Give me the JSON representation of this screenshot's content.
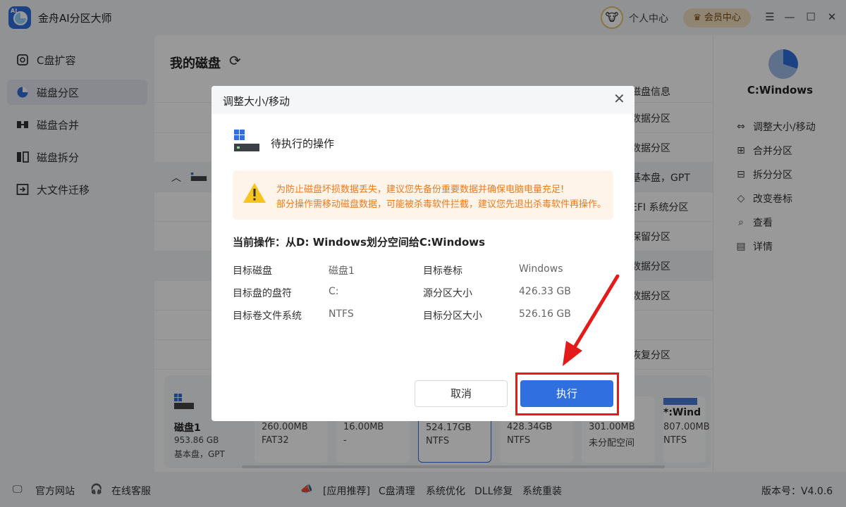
{
  "app": {
    "title": "金舟AI分区大师",
    "logo_text": "AI",
    "user_center": "个人中心",
    "member_center": "会员中心",
    "version": "版本号：V4.0.6"
  },
  "sidebar": {
    "items": [
      {
        "label": "C盘扩容",
        "icon": "drive-icon"
      },
      {
        "label": "磁盘分区",
        "icon": "partition-pie-icon",
        "active": true
      },
      {
        "label": "磁盘合并",
        "icon": "merge-icon"
      },
      {
        "label": "磁盘拆分",
        "icon": "split-icon"
      },
      {
        "label": "大文件迁移",
        "icon": "migrate-icon"
      }
    ]
  },
  "main": {
    "title": "我的磁盘",
    "column_header": "磁盘信息",
    "rows": [
      "数据分区",
      "数据分区",
      "基本盘，GPT",
      "EFI 系统分区",
      "保留分区",
      "数据分区",
      "数据分区",
      "",
      "恢复分区"
    ]
  },
  "disk_strip": {
    "disk_name": "磁盘1",
    "disk_size": "953.86 GB",
    "disk_type": "基本盘，GPT",
    "partitions": [
      {
        "size": "260.00MB",
        "fs": "FAT32",
        "name": ""
      },
      {
        "size": "16.00MB",
        "fs": "-",
        "name": ""
      },
      {
        "size": "524.17GB",
        "fs": "NTFS",
        "name": "",
        "selected": true
      },
      {
        "size": "428.34GB",
        "fs": "NTFS",
        "name": ""
      },
      {
        "size": "301.00MB",
        "fs": "未分配空间",
        "name": ""
      },
      {
        "size": "807.00MB",
        "fs": "NTFS",
        "name": "*:Wind"
      }
    ]
  },
  "right_panel": {
    "title": "C:Windows",
    "actions": [
      {
        "label": "调整大小/移动",
        "icon": "resize-icon"
      },
      {
        "label": "合并分区",
        "icon": "merge-icon"
      },
      {
        "label": "拆分分区",
        "icon": "split-icon"
      },
      {
        "label": "改变卷标",
        "icon": "tag-icon"
      },
      {
        "label": "查看",
        "icon": "search-doc-icon"
      },
      {
        "label": "详情",
        "icon": "detail-icon"
      }
    ]
  },
  "footer": {
    "website": "官方网站",
    "service": "在线客服",
    "recommend": "[应用推荐]",
    "links": [
      "C盘清理",
      "系统优化",
      "DLL修复",
      "系统重装"
    ]
  },
  "dialog": {
    "title": "调整大小/移动",
    "pending_label": "待执行的操作",
    "warning_line1": "为防止磁盘坏损数据丢失，建议您先备份重要数据并确保电脑电量充足!",
    "warning_line2": "部分操作需移动磁盘数据，可能被杀毒软件拦截，建议您先退出杀毒软件再操作。",
    "current_op_label": "当前操作：",
    "current_op_value": "从D: Windows划分空间给C:Windows",
    "details_left": [
      {
        "key": "目标磁盘",
        "value": "磁盘1"
      },
      {
        "key": "目标盘的盘符",
        "value": "C:"
      },
      {
        "key": "目标卷文件系统",
        "value": "NTFS"
      }
    ],
    "details_right": [
      {
        "key": "目标卷标",
        "value": "Windows"
      },
      {
        "key": "源分区大小",
        "value": "426.33 GB"
      },
      {
        "key": "目标分区大小",
        "value": "526.16 GB"
      }
    ],
    "cancel_label": "取消",
    "execute_label": "执行"
  },
  "colors": {
    "accent": "#2f6fe0",
    "warning_text": "#ef7a1a",
    "warning_bg": "#fff4ea",
    "highlight_red": "#e51a1a",
    "member_bg": "#f1dcc0"
  }
}
